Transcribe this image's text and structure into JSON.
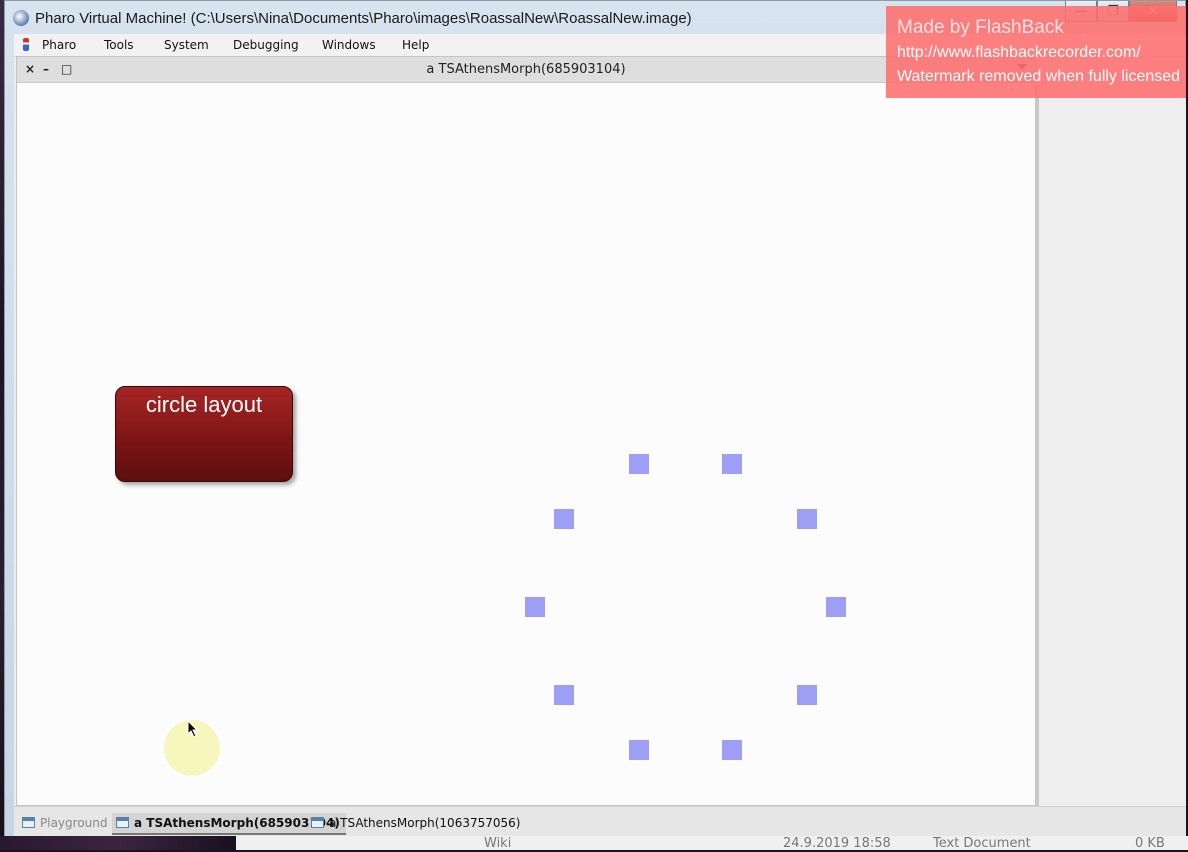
{
  "os_window": {
    "title": "Pharo Virtual Machine! (C:\\Users\\Nina\\Documents\\Pharo\\images\\RoassalNew\\RoassalNew.image)",
    "minimize": "—",
    "maximize": "❐",
    "close": "✕"
  },
  "menubar": {
    "items": [
      "Pharo",
      "Tools",
      "System",
      "Debugging",
      "Windows",
      "Help"
    ]
  },
  "pharo_window": {
    "title": "a TSAthensMorph(685903104)",
    "close": "×",
    "minimize": "–",
    "maximize": "□"
  },
  "canvas": {
    "button_label": "circle layout",
    "node_color": "#9e9ef7",
    "node_count": 10
  },
  "taskbar": {
    "items": [
      {
        "label": "Playground",
        "state": "inactive"
      },
      {
        "label": "a TSAthensMorph(685903104)",
        "state": "active"
      },
      {
        "label": "a TSAthensMorph(1063757056)",
        "state": "normal"
      }
    ]
  },
  "watermark": {
    "title": "Made by FlashBack",
    "url": "http://www.flashbackrecorder.com/",
    "note": "Watermark removed when fully licensed"
  },
  "background_explorer": {
    "name": "Wiki",
    "date": "24.9.2019 18:58",
    "type": "Text Document",
    "size": "0 KB"
  }
}
